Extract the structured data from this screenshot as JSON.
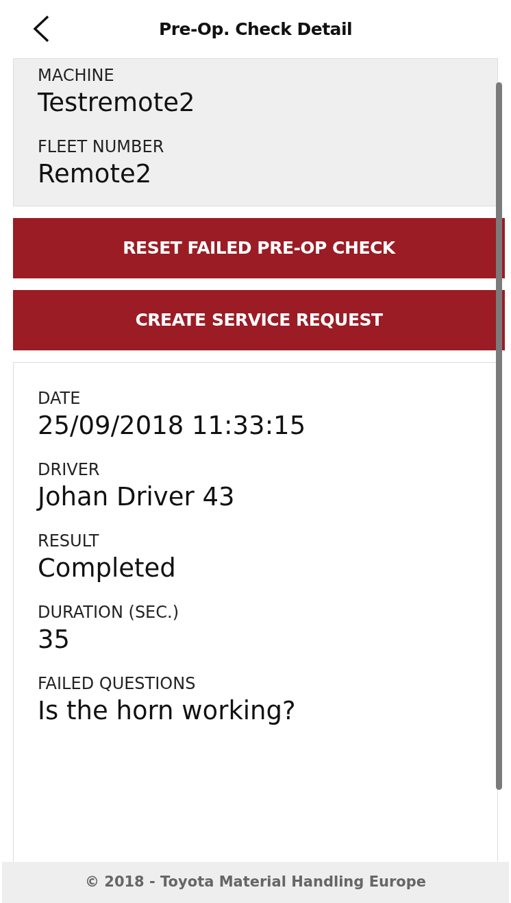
{
  "header": {
    "title": "Pre-Op. Check Detail"
  },
  "machine_card": {
    "fields": [
      {
        "label": "MACHINE",
        "value": "Testremote2"
      },
      {
        "label": "FLEET NUMBER",
        "value": "Remote2"
      }
    ]
  },
  "buttons": [
    "RESET FAILED PRE-OP CHECK",
    "CREATE SERVICE REQUEST"
  ],
  "detail_card": {
    "fields": [
      {
        "label": "DATE",
        "value": "25/09/2018 11:33:15"
      },
      {
        "label": "DRIVER",
        "value": "Johan Driver 43"
      },
      {
        "label": "RESULT",
        "value": "Completed"
      },
      {
        "label": "DURATION (SEC.)",
        "value": "35"
      },
      {
        "label": "FAILED QUESTIONS",
        "value": "Is the horn working?"
      }
    ]
  },
  "footer": {
    "text": "© 2018 - Toyota Material Handling Europe"
  }
}
